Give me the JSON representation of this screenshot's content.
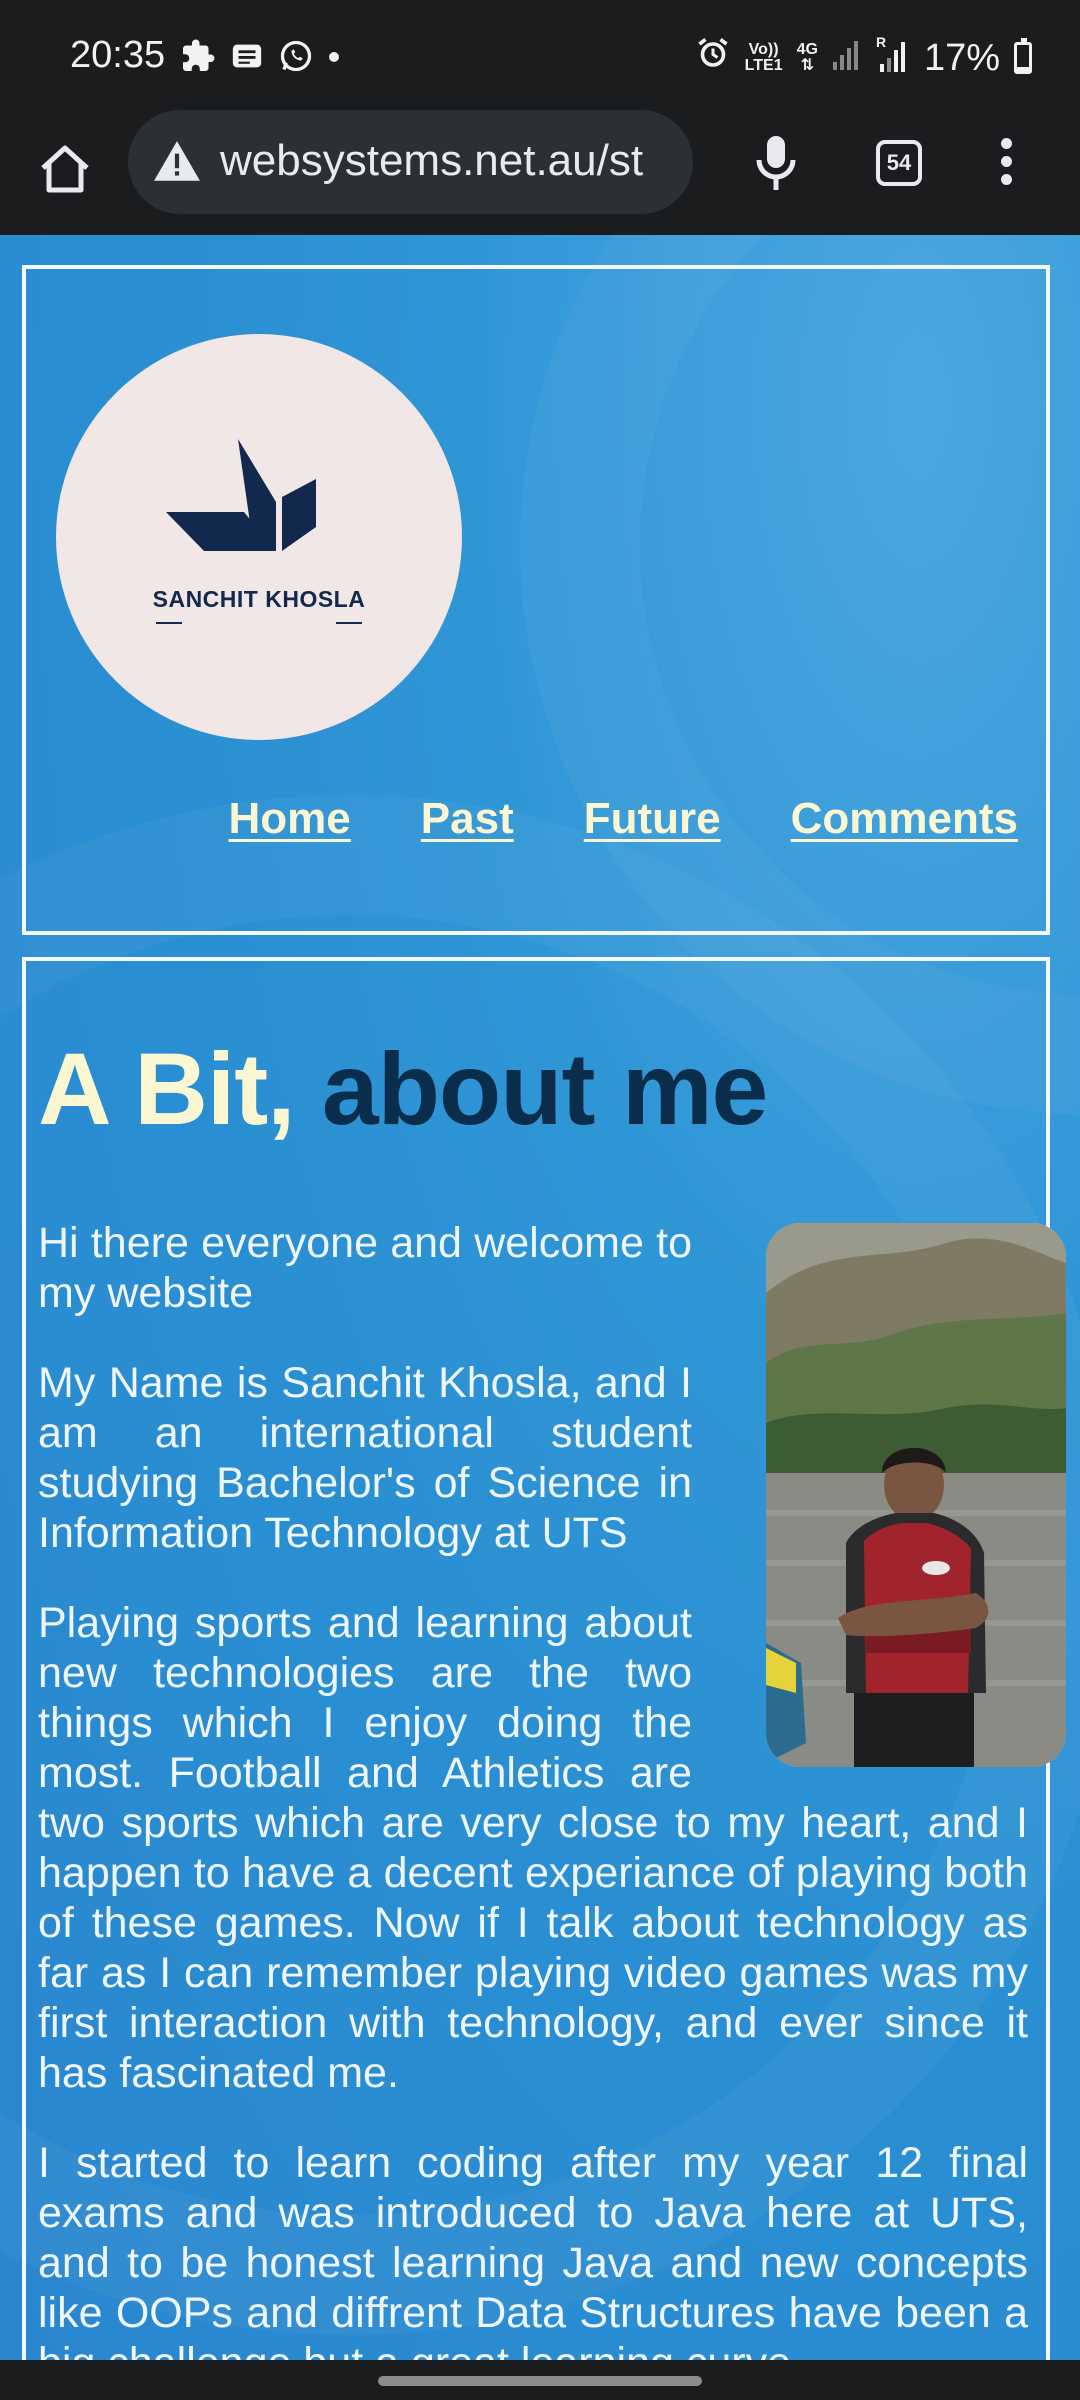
{
  "status_bar": {
    "time": "20:35",
    "network_label_top": "Vo))",
    "network_label_bottom": "LTE1",
    "network_type": "4G",
    "roaming_label": "R",
    "battery": "17%",
    "battery_level": 0.17
  },
  "browser": {
    "url": "websystems.net.au/st",
    "tab_count": "54"
  },
  "logo": {
    "text": "SANCHIT KHOSLA",
    "colors": {
      "circle": "#f1e7e6",
      "mark": "#13284d"
    }
  },
  "nav": {
    "items": [
      {
        "label": "Home"
      },
      {
        "label": "Past"
      },
      {
        "label": "Future"
      },
      {
        "label": "Comments"
      }
    ]
  },
  "content": {
    "title_part1": "A Bit,",
    "title_part2": "about me",
    "paragraphs": [
      "Hi there everyone and welcome to my website",
      "My Name is Sanchit Khosla, and I am an international student studying Bachelor's of Science in Information Technology at UTS",
      "Playing sports and learning about new technologies are the two things which I enjoy doing the most. Football and Athletics are two sports which are very close to my heart, and I happen to have a decent experiance of playing both of these games. Now if I talk about technology as far as I can remember playing video games was my first interaction with technology, and ever since it has fascinated me.",
      "I started to learn coding after my year 12 final exams and was introduced to Java here at UTS, and to be honest learning Java and new concepts like OOPs and diffrent Data Structures have been a big challenge but a great learning curve"
    ]
  },
  "theme": {
    "page_blue": "#2a8fd2",
    "accent_cream": "#fbf7d2",
    "title_navy": "#0b2d4c"
  }
}
